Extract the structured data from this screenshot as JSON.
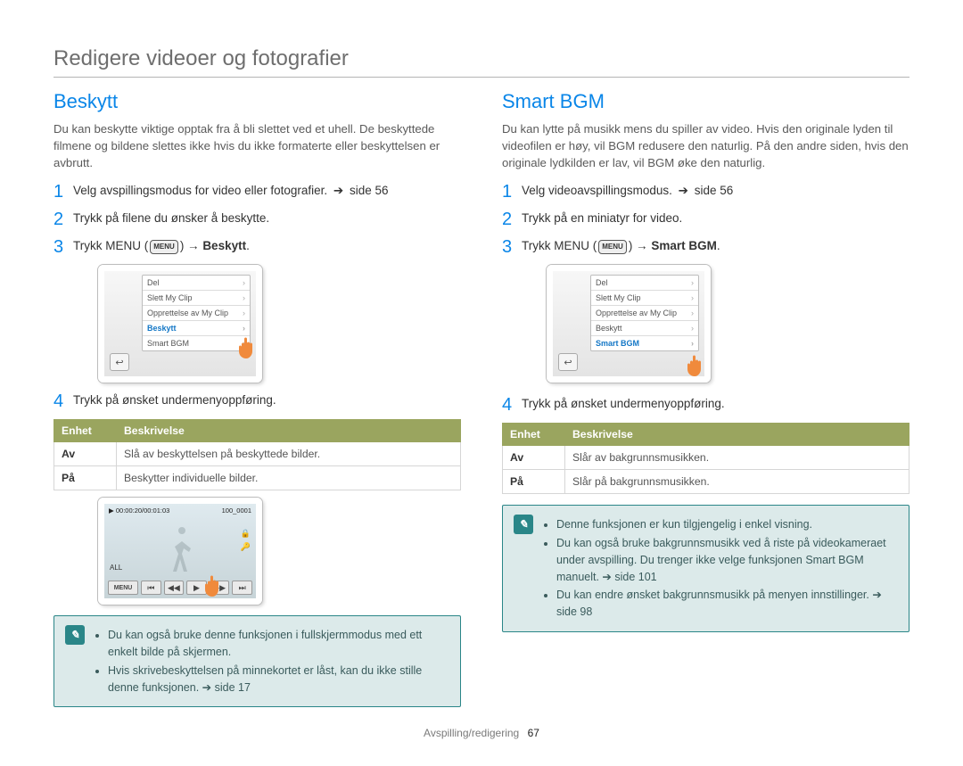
{
  "pageTitle": "Redigere videoer og fotografier",
  "left": {
    "heading": "Beskytt",
    "lead": "Du kan beskytte viktige opptak fra å bli slettet ved et uhell. De beskyttede filmene og bildene slettes ikke hvis du ikke formaterte eller beskyttelsen er avbrutt.",
    "steps": [
      {
        "n": "1",
        "text": "Velg avspillingsmodus for video eller fotografier.",
        "suffix": "side 56",
        "suffixArrow": true
      },
      {
        "n": "2",
        "text": "Trykk på filene du ønsker å beskytte."
      },
      {
        "n": "3",
        "prefix": "Trykk MENU (",
        "midBadge": "MENU",
        "mid": ") → ",
        "bold": "Beskytt",
        "end": "."
      }
    ],
    "menuItems": [
      {
        "label": "Del",
        "sel": false
      },
      {
        "label": "Slett My Clip",
        "sel": false
      },
      {
        "label": "Opprettelse av My Clip",
        "sel": false
      },
      {
        "label": "Beskytt",
        "sel": true
      },
      {
        "label": "Smart BGM",
        "sel": false
      }
    ],
    "step4": "Trykk på ønsket undermenyoppføring.",
    "table": {
      "h1": "Enhet",
      "h2": "Beskrivelse",
      "rows": [
        {
          "k": "Av",
          "v": "Slå av beskyttelsen på beskyttede bilder."
        },
        {
          "k": "På",
          "v": "Beskytter individuelle bilder."
        }
      ]
    },
    "playback": {
      "topLeft": "▶ 00:00:20/00:01:03",
      "topRight": "100_0001",
      "leftIcon": "ALL",
      "menuLabel": "MENU"
    },
    "notes": [
      "Du kan også bruke denne funksjonen i fullskjermmodus med ett enkelt bilde på skjermen.",
      "Hvis skrivebeskyttelsen på minnekortet er låst, kan du ikke stille denne funksjonen. ➔ side 17"
    ]
  },
  "right": {
    "heading": "Smart BGM",
    "lead": "Du kan lytte på musikk mens du spiller av video. Hvis den originale lyden til videofilen er høy, vil BGM redusere den naturlig. På den andre siden, hvis den originale lydkilden er lav, vil BGM øke den naturlig.",
    "steps": [
      {
        "n": "1",
        "text": "Velg videoavspillingsmodus.",
        "suffix": "side 56",
        "suffixArrow": true
      },
      {
        "n": "2",
        "text": "Trykk på en miniatyr for video."
      },
      {
        "n": "3",
        "prefix": "Trykk MENU (",
        "midBadge": "MENU",
        "mid": ") → ",
        "bold": "Smart BGM",
        "end": "."
      }
    ],
    "menuItems": [
      {
        "label": "Del",
        "sel": false
      },
      {
        "label": "Slett My Clip",
        "sel": false
      },
      {
        "label": "Opprettelse av My Clip",
        "sel": false
      },
      {
        "label": "Beskytt",
        "sel": false
      },
      {
        "label": "Smart BGM",
        "sel": true
      }
    ],
    "step4": "Trykk på ønsket undermenyoppføring.",
    "table": {
      "h1": "Enhet",
      "h2": "Beskrivelse",
      "rows": [
        {
          "k": "Av",
          "v": "Slår av bakgrunnsmusikken."
        },
        {
          "k": "På",
          "v": "Slår på bakgrunnsmusikken."
        }
      ]
    },
    "notes": [
      "Denne funksjonen er kun tilgjengelig i enkel visning.",
      "Du kan også bruke bakgrunnsmusikk ved å riste på videokameraet under avspilling. Du trenger ikke velge funksjonen Smart BGM manuelt. ➔ side 101",
      "Du kan endre ønsket bakgrunnsmusikk på menyen innstillinger. ➔ side 98"
    ]
  },
  "footer": {
    "section": "Avspilling/redigering",
    "page": "67"
  }
}
